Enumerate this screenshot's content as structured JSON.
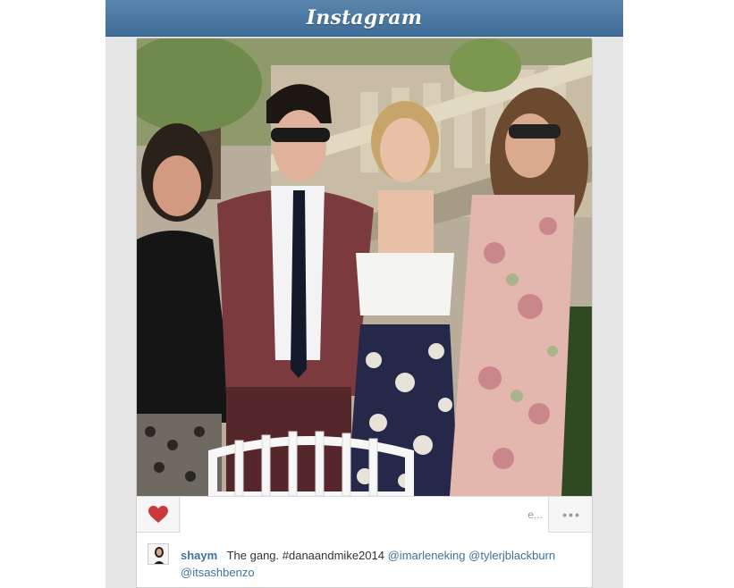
{
  "header": {
    "logo_text": "Instagram"
  },
  "post": {
    "likes_text": "e...",
    "more_label": "•••",
    "caption": {
      "username": "shaym",
      "text": "The gang.",
      "hashtag": "#danaandmike2014",
      "mentions": [
        "@imarleneking",
        "@tylerjblackburn",
        "@itsashbenzo"
      ]
    }
  },
  "icons": {
    "like": "heart-icon",
    "more": "ellipsis-icon"
  },
  "colors": {
    "header": "#4e7ca6",
    "heart": "#c9393d",
    "link": "#3f729b",
    "background": "#e6e6e6"
  }
}
